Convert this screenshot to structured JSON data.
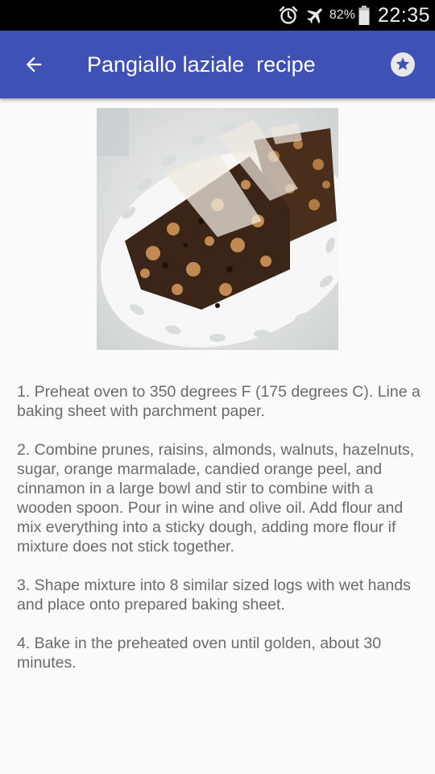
{
  "status_bar": {
    "icons": [
      "alarm-icon",
      "airplane-mode-icon",
      "battery-icon"
    ],
    "battery": "82%",
    "time": "22:35"
  },
  "app_bar": {
    "title": "Pangiallo laziale  recipe",
    "back_icon": "arrow-back-icon",
    "favorite_icon": "star-icon",
    "color": "#3f51b5"
  },
  "recipe": {
    "image": "pangiallo-photo",
    "steps": [
      "1. Preheat oven to 350 degrees F (175 degrees C). Line a baking sheet with parchment paper.",
      "2. Combine prunes, raisins, almonds, walnuts, hazelnuts, sugar, orange marmalade, candied orange peel, and cinnamon in a large bowl and stir to combine with a wooden spoon. Pour in wine and olive oil. Add flour and mix everything into a sticky dough, adding more flour if mixture does not stick together.",
      "3. Shape mixture into 8 similar sized logs with wet hands and place onto prepared baking sheet.",
      "4. Bake in the preheated oven until golden, about 30 minutes."
    ]
  }
}
